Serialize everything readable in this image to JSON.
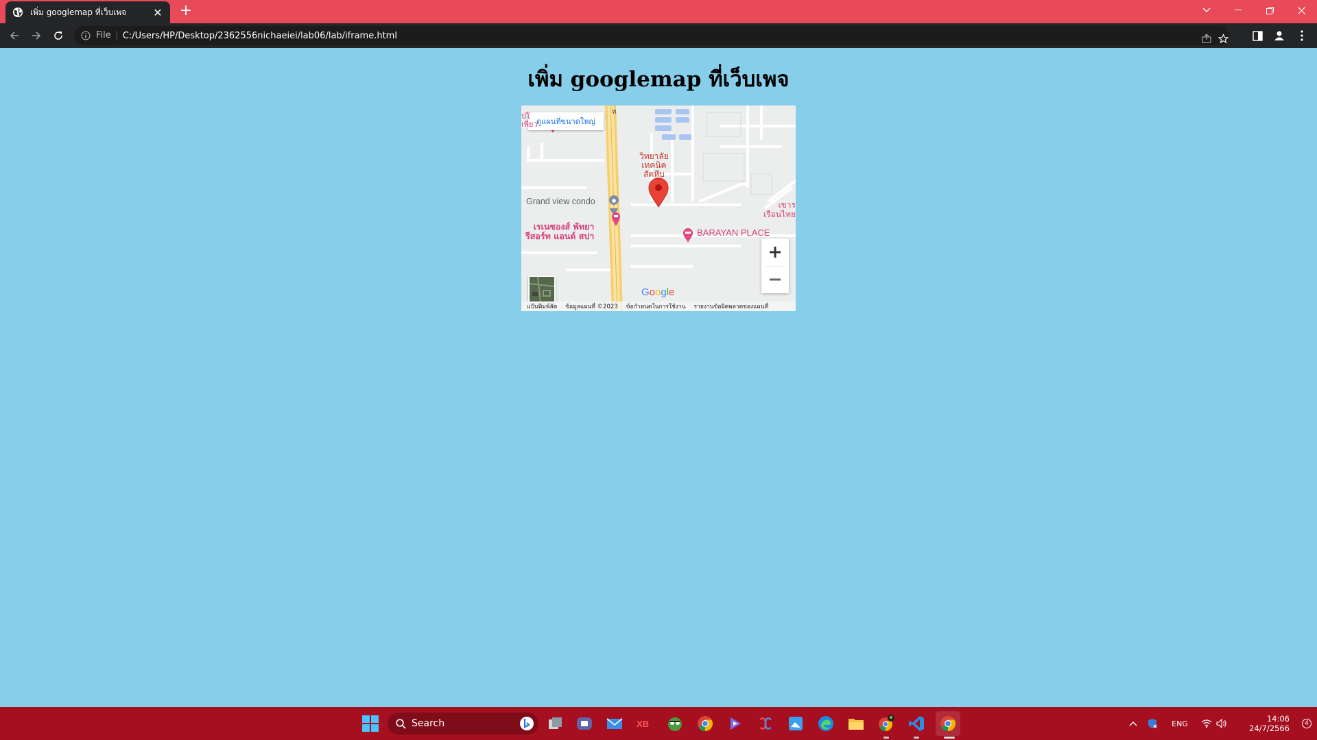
{
  "browser": {
    "tab_title": "เพิ่ม googlemap ที่เว็บเพจ",
    "new_tab_icon": "plus-icon",
    "address": {
      "scheme_label": "File",
      "url": "C:/Users/HP/Desktop/2362556nichaeiei/lab06/lab/iframe.html"
    }
  },
  "page": {
    "heading": "เพิ่ม googlemap ที่เว็บเพจ",
    "background_color": "#87ceeb"
  },
  "map": {
    "view_larger_label": "ดูแผนที่ขนาดใหญ่",
    "labels": {
      "college": [
        "วิทยาลัย",
        "เทคนิค",
        "สัตหีบ"
      ],
      "grand_view": "Grand view condo",
      "resort": [
        "เรเนซองส์ พัทยา",
        "รีสอร์ท แอนด์ สปา"
      ],
      "barayan": "BARAYAN PLACE",
      "top_left": [
        "ปใ",
        "เพียว"
      ],
      "right_edge": [
        "เขาร",
        "เรือนไทย"
      ],
      "road_num": "ท"
    },
    "zoom_in": "+",
    "zoom_out": "−",
    "logo": [
      "G",
      "o",
      "o",
      "g",
      "l",
      "e"
    ],
    "footer": {
      "shortcuts": "แป้นพิมพ์ลัด",
      "data": "ข้อมูลแผนที่ ©2023",
      "terms": "ข้อกำหนดในการใช้งาน",
      "report": "รายงานข้อผิดพลาดของแผนที่"
    }
  },
  "taskbar": {
    "search_label": "Search",
    "apps": [
      "task-view",
      "teams-chat",
      "mail",
      "xbox",
      "game",
      "chrome",
      "copilot",
      "media",
      "photos",
      "edge",
      "file-explorer",
      "chrome-profile",
      "vscode",
      "chrome-active"
    ],
    "tray": {
      "language": "ENG",
      "time": "14:06",
      "date": "24/7/2566",
      "notifications": "4"
    }
  }
}
